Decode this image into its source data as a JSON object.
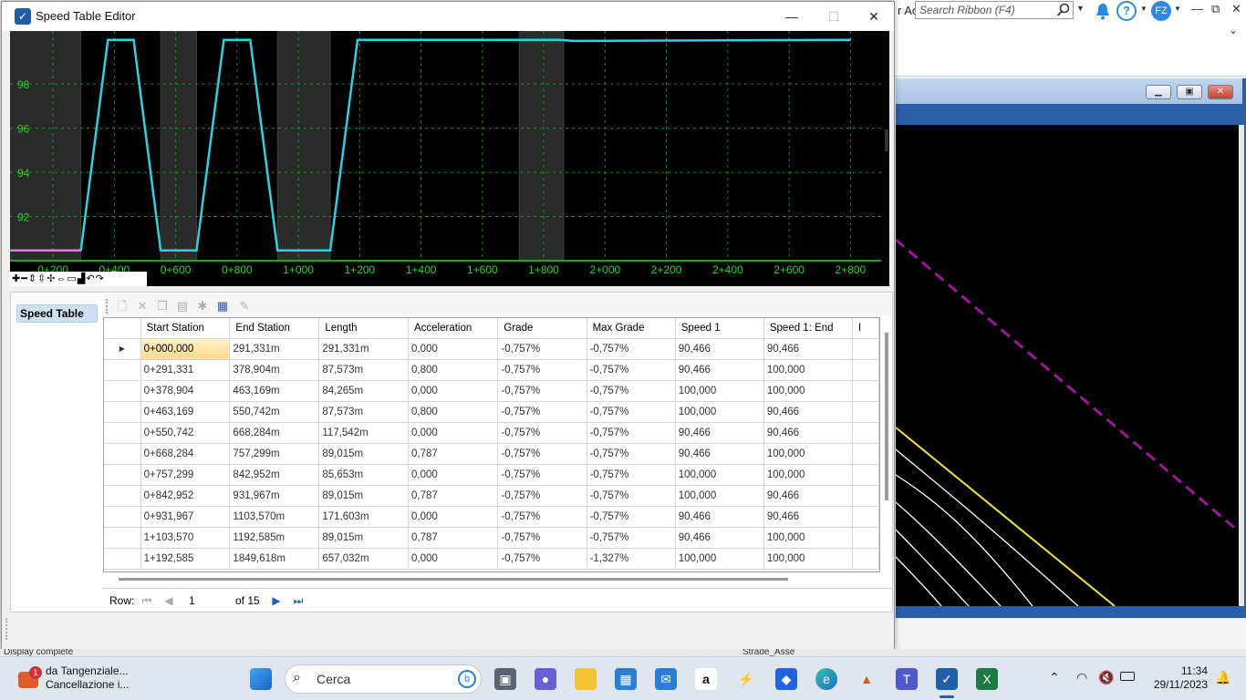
{
  "dialog": {
    "title": "Speed Table Editor",
    "minimize": "—",
    "maximize": "☐",
    "close": "✕"
  },
  "background": {
    "search_placeholder": "Search Ribbon (F4)",
    "ribbon_cut_text": "r Ac",
    "user_initials": "FZ",
    "status_left": "Display complete",
    "status_right": "Strade_Asse"
  },
  "chart_data": {
    "type": "line",
    "x_ticks": [
      "0+200",
      "0+400",
      "0+600",
      "0+800",
      "1+000",
      "1+200",
      "1+400",
      "1+600",
      "1+800",
      "2+000",
      "2+200",
      "2+400",
      "2+600",
      "2+800"
    ],
    "y_ticks": [
      "98",
      "96",
      "94",
      "92"
    ],
    "xlim": [
      60,
      2900
    ],
    "ylim": [
      90,
      100.4
    ],
    "grid": true,
    "series": [
      {
        "color": "#29d3e6",
        "x": [
          291,
          379,
          463,
          551,
          668,
          757,
          843,
          932,
          1104,
          1193,
          1850,
          1900,
          2800
        ],
        "values": [
          90.466,
          100,
          100,
          90.466,
          90.466,
          100,
          100,
          90.466,
          90.466,
          100,
          100,
          99.95,
          100
        ]
      },
      {
        "color": "#e27ae0",
        "x": [
          0,
          291
        ],
        "values": [
          90.466,
          90.466
        ]
      }
    ],
    "shaded_bands": [
      [
        0,
        291
      ],
      [
        551,
        668
      ],
      [
        932,
        1104
      ],
      [
        1720,
        1865
      ]
    ]
  },
  "nav": {
    "speed_table": "Speed Table"
  },
  "table": {
    "columns": [
      "Start Station",
      "End Station",
      "Length",
      "Acceleration",
      "Grade",
      "Max Grade",
      "Speed 1",
      "Speed 1: End",
      "I"
    ],
    "rows": [
      [
        "0+000,000",
        "291,331m",
        "291,331m",
        "0,000",
        "-0,757%",
        "-0,757%",
        "90,466",
        "90,466"
      ],
      [
        "0+291,331",
        "378,904m",
        "87,573m",
        "0,800",
        "-0,757%",
        "-0,757%",
        "90,466",
        "100,000"
      ],
      [
        "0+378,904",
        "463,169m",
        "84,265m",
        "0,000",
        "-0,757%",
        "-0,757%",
        "100,000",
        "100,000"
      ],
      [
        "0+463,169",
        "550,742m",
        "87,573m",
        "0,800",
        "-0,757%",
        "-0,757%",
        "100,000",
        "90,466"
      ],
      [
        "0+550,742",
        "668,284m",
        "117,542m",
        "0,000",
        "-0,757%",
        "-0,757%",
        "90,466",
        "90,466"
      ],
      [
        "0+668,284",
        "757,299m",
        "89,015m",
        "0,787",
        "-0,757%",
        "-0,757%",
        "90,466",
        "100,000"
      ],
      [
        "0+757,299",
        "842,952m",
        "85,653m",
        "0,000",
        "-0,757%",
        "-0,757%",
        "100,000",
        "100,000"
      ],
      [
        "0+842,952",
        "931,967m",
        "89,015m",
        "0,787",
        "-0,757%",
        "-0,757%",
        "100,000",
        "90,466"
      ],
      [
        "0+931,967",
        "1103,570m",
        "171,603m",
        "0,000",
        "-0,757%",
        "-0,757%",
        "90,466",
        "90,466"
      ],
      [
        "1+103,570",
        "1192,585m",
        "89,015m",
        "0,787",
        "-0,757%",
        "-0,757%",
        "90,466",
        "100,000"
      ],
      [
        "1+192,585",
        "1849,618m",
        "657,032m",
        "0,000",
        "-0,757%",
        "-1,327%",
        "100,000",
        "100,000"
      ]
    ]
  },
  "pager": {
    "row_label": "Row:",
    "current": "1",
    "of_label": "of 15"
  },
  "taskbar": {
    "notification_title": "da Tangenziale...",
    "notification_sub": "Cancellazione i...",
    "search_label": "Cerca",
    "time": "11:34",
    "date": "29/11/2023",
    "badge": "1"
  }
}
